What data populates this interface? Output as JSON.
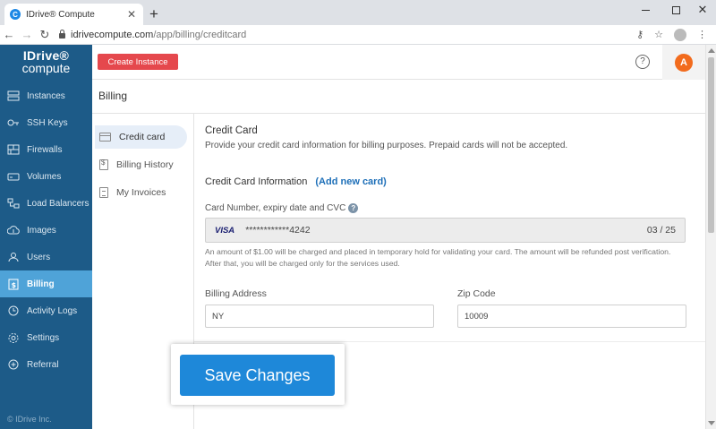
{
  "browser": {
    "tab_title": "IDrive® Compute",
    "favicon_letter": "C",
    "new_tab": "+",
    "url_host": "idrivecompute.com",
    "url_path": "/app/billing/creditcard"
  },
  "brand": {
    "logo_top": "IDrive®",
    "logo_bottom": "compute",
    "footer": "© IDrive Inc."
  },
  "sidebar": {
    "items": [
      {
        "label": "Instances",
        "icon": "instances-icon"
      },
      {
        "label": "SSH Keys",
        "icon": "key-icon"
      },
      {
        "label": "Firewalls",
        "icon": "firewall-icon"
      },
      {
        "label": "Volumes",
        "icon": "volume-icon"
      },
      {
        "label": "Load Balancers",
        "icon": "load-balancer-icon"
      },
      {
        "label": "Images",
        "icon": "cloud-upload-icon"
      },
      {
        "label": "Users",
        "icon": "user-icon"
      },
      {
        "label": "Billing",
        "icon": "billing-icon",
        "active": true
      },
      {
        "label": "Activity Logs",
        "icon": "history-icon"
      },
      {
        "label": "Settings",
        "icon": "gear-icon"
      },
      {
        "label": "Referral",
        "icon": "referral-icon"
      }
    ]
  },
  "appbar": {
    "create_label": "Create Instance",
    "help": "?",
    "avatar_letter": "A"
  },
  "page": {
    "title": "Billing"
  },
  "subnav": {
    "items": [
      {
        "label": "Credit card",
        "active": true
      },
      {
        "label": "Billing History"
      },
      {
        "label": "My Invoices"
      }
    ]
  },
  "credit_card": {
    "title": "Credit Card",
    "description": "Provide your credit card information for billing purposes. Prepaid cards will not be accepted.",
    "info_heading": "Credit Card Information",
    "add_new": "(Add new card)",
    "card_label": "Card Number, expiry date and CVC",
    "card_brand": "VISA",
    "card_number": "************4242",
    "card_expiry": "03 / 25",
    "note": "An amount of $1.00 will be charged and placed in temporary hold for validating your card. The amount will be refunded post verification. After that, you will be charged only for the services used.",
    "billing_address_label": "Billing Address",
    "billing_address_value": "NY",
    "zip_label": "Zip Code",
    "zip_value": "10009"
  },
  "save": {
    "label": "Save Changes"
  },
  "colors": {
    "sidebar_bg": "#1d5b88",
    "sidebar_active": "#4fa3d8",
    "create_button": "#e5484d",
    "save_button": "#1e88d9",
    "avatar": "#f26b1d",
    "link": "#1d6fb8"
  }
}
